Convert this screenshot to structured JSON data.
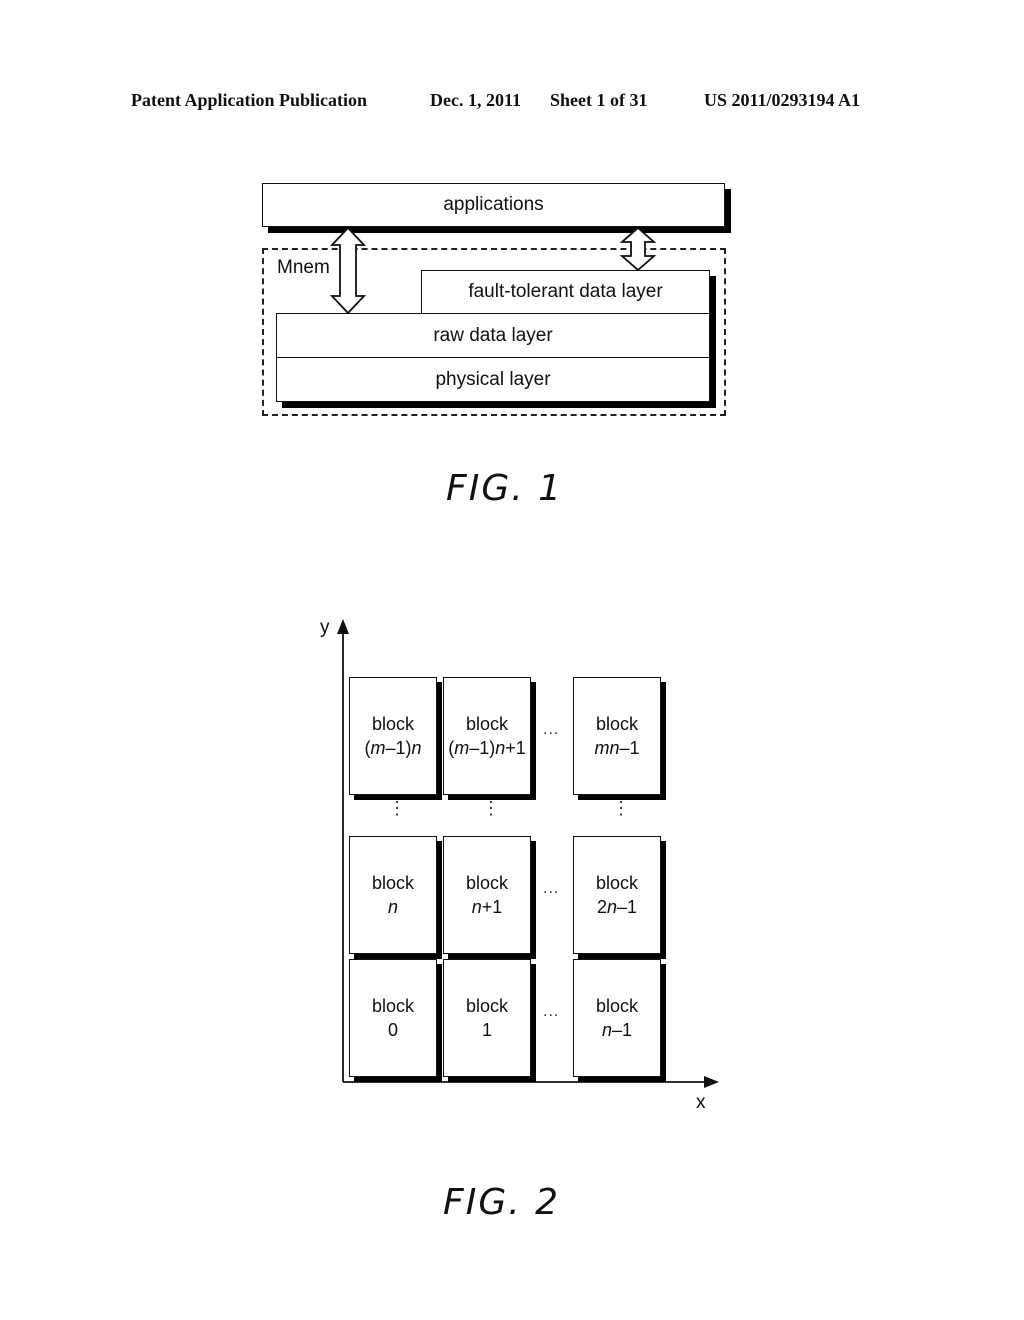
{
  "header": {
    "publication": "Patent Application Publication",
    "date": "Dec. 1, 2011",
    "sheet": "Sheet 1 of 31",
    "number": "US 2011/0293194 A1"
  },
  "fig1": {
    "applications": "applications",
    "mnem_label": "Mnem",
    "fault_tolerant_layer": "fault-tolerant data layer",
    "raw_data_layer": "raw data layer",
    "physical_layer": "physical layer",
    "caption": "FIG. 1"
  },
  "fig2": {
    "y_axis_label": "y",
    "x_axis_label": "x",
    "ellipsis_h": "...",
    "ellipsis_v": "⋮",
    "rows": [
      {
        "blocks": [
          {
            "word": "block",
            "index_html": "(<i>m</i>–1)<i>n</i>"
          },
          {
            "word": "block",
            "index_html": "(<i>m</i>–1)<i>n</i>+1"
          },
          {
            "word": "block",
            "index_html": "<i>mn</i>–1"
          }
        ]
      },
      {
        "blocks": [
          {
            "word": "block",
            "index_html": "<i>n</i>"
          },
          {
            "word": "block",
            "index_html": "<i>n</i>+1"
          },
          {
            "word": "block",
            "index_html": "2<i>n</i>–1"
          }
        ]
      },
      {
        "blocks": [
          {
            "word": "block",
            "index_html": "0"
          },
          {
            "word": "block",
            "index_html": "1"
          },
          {
            "word": "block",
            "index_html": "<i>n</i>–1"
          }
        ]
      }
    ],
    "caption": "FIG. 2"
  }
}
